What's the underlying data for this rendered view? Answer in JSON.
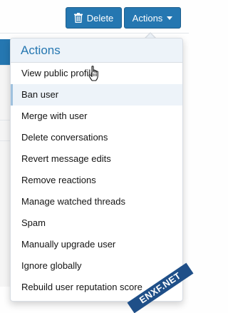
{
  "buttons": {
    "delete_label": "Delete",
    "actions_label": "Actions"
  },
  "menu": {
    "title": "Actions",
    "items": [
      {
        "label": "View public profile"
      },
      {
        "label": "Ban user",
        "state": "hovered"
      },
      {
        "label": "Merge with user"
      },
      {
        "label": "Delete conversations"
      },
      {
        "label": "Revert message edits"
      },
      {
        "label": "Remove reactions"
      },
      {
        "label": "Manage watched threads"
      },
      {
        "label": "Spam"
      },
      {
        "label": "Manually upgrade user"
      },
      {
        "label": "Ignore globally"
      },
      {
        "label": "Rebuild user reputation score"
      }
    ]
  },
  "watermark": "ENXF.NET",
  "colors": {
    "primary": "#2577b1",
    "menu_header_bg": "#edf3f9",
    "menu_text": "#141414"
  },
  "icons": {
    "delete": "trash-icon",
    "actions": "caret-down-icon",
    "pointer": "hand-cursor-icon"
  }
}
